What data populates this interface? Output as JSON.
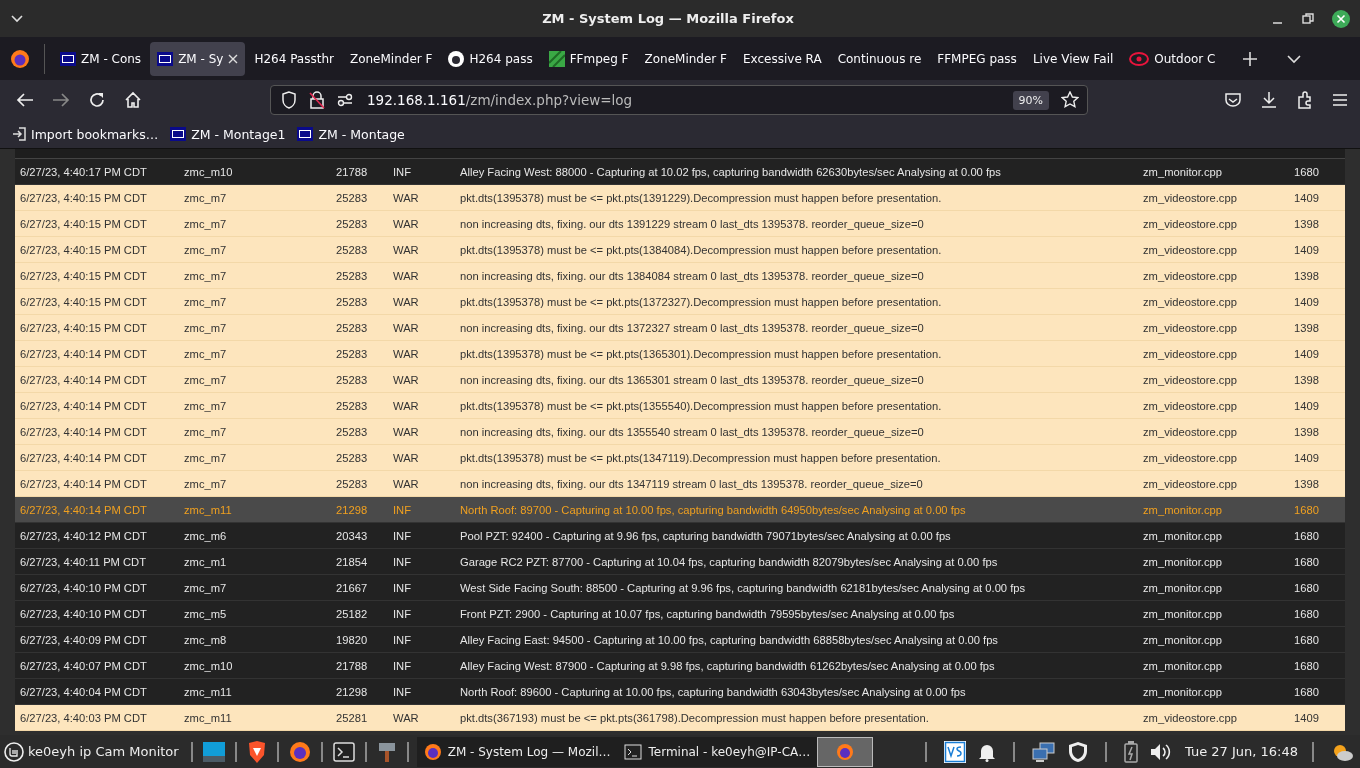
{
  "window": {
    "title": "ZM - System Log — Mozilla Firefox"
  },
  "tabs": [
    {
      "label": "ZM - Cons",
      "kind": "zm",
      "selected": false
    },
    {
      "label": "ZM - Sy",
      "kind": "zm",
      "selected": true
    },
    {
      "label": "H264 Passthr",
      "kind": "plain",
      "selected": false
    },
    {
      "label": "ZoneMinder F",
      "kind": "plain",
      "selected": false
    },
    {
      "label": "H264 pass",
      "kind": "github",
      "selected": false
    },
    {
      "label": "FFmpeg F",
      "kind": "ffmpeg",
      "selected": false
    },
    {
      "label": "ZoneMinder F",
      "kind": "plain",
      "selected": false
    },
    {
      "label": "Excessive RA",
      "kind": "plain",
      "selected": false
    },
    {
      "label": "Continuous re",
      "kind": "plain",
      "selected": false
    },
    {
      "label": "FFMPEG pass",
      "kind": "plain",
      "selected": false
    },
    {
      "label": "Live View Fail",
      "kind": "plain",
      "selected": false
    },
    {
      "label": "Outdoor C",
      "kind": "eye",
      "selected": false
    }
  ],
  "address": {
    "host": "192.168.1.161",
    "path": "/zm/index.php?view=log",
    "zoom": "90%"
  },
  "bookmarks": [
    {
      "label": "Import bookmarks…",
      "kind": "import"
    },
    {
      "label": "ZM - Montage1",
      "kind": "zm"
    },
    {
      "label": "ZM - Montage",
      "kind": "zm"
    }
  ],
  "log": {
    "rows": [
      {
        "time": "6/27/23, 4:40:17 PM CDT",
        "component": "zmc_m10",
        "pid": "21788",
        "level": "INF",
        "message": "Alley Facing West: 88000 - Capturing at 10.02 fps, capturing bandwidth 62630bytes/sec Analysing at 0.00 fps",
        "file": "zm_monitor.cpp",
        "line": "1680",
        "selected": false
      },
      {
        "time": "6/27/23, 4:40:15 PM CDT",
        "component": "zmc_m7",
        "pid": "25283",
        "level": "WAR",
        "message": "pkt.dts(1395378) must be <= pkt.pts(1391229).Decompression must happen before presentation.",
        "file": "zm_videostore.cpp",
        "line": "1409",
        "selected": false
      },
      {
        "time": "6/27/23, 4:40:15 PM CDT",
        "component": "zmc_m7",
        "pid": "25283",
        "level": "WAR",
        "message": "non increasing dts, fixing. our dts 1391229 stream 0 last_dts 1395378. reorder_queue_size=0",
        "file": "zm_videostore.cpp",
        "line": "1398",
        "selected": false
      },
      {
        "time": "6/27/23, 4:40:15 PM CDT",
        "component": "zmc_m7",
        "pid": "25283",
        "level": "WAR",
        "message": "pkt.dts(1395378) must be <= pkt.pts(1384084).Decompression must happen before presentation.",
        "file": "zm_videostore.cpp",
        "line": "1409",
        "selected": false
      },
      {
        "time": "6/27/23, 4:40:15 PM CDT",
        "component": "zmc_m7",
        "pid": "25283",
        "level": "WAR",
        "message": "non increasing dts, fixing. our dts 1384084 stream 0 last_dts 1395378. reorder_queue_size=0",
        "file": "zm_videostore.cpp",
        "line": "1398",
        "selected": false
      },
      {
        "time": "6/27/23, 4:40:15 PM CDT",
        "component": "zmc_m7",
        "pid": "25283",
        "level": "WAR",
        "message": "pkt.dts(1395378) must be <= pkt.pts(1372327).Decompression must happen before presentation.",
        "file": "zm_videostore.cpp",
        "line": "1409",
        "selected": false
      },
      {
        "time": "6/27/23, 4:40:15 PM CDT",
        "component": "zmc_m7",
        "pid": "25283",
        "level": "WAR",
        "message": "non increasing dts, fixing. our dts 1372327 stream 0 last_dts 1395378. reorder_queue_size=0",
        "file": "zm_videostore.cpp",
        "line": "1398",
        "selected": false
      },
      {
        "time": "6/27/23, 4:40:14 PM CDT",
        "component": "zmc_m7",
        "pid": "25283",
        "level": "WAR",
        "message": "pkt.dts(1395378) must be <= pkt.pts(1365301).Decompression must happen before presentation.",
        "file": "zm_videostore.cpp",
        "line": "1409",
        "selected": false
      },
      {
        "time": "6/27/23, 4:40:14 PM CDT",
        "component": "zmc_m7",
        "pid": "25283",
        "level": "WAR",
        "message": "non increasing dts, fixing. our dts 1365301 stream 0 last_dts 1395378. reorder_queue_size=0",
        "file": "zm_videostore.cpp",
        "line": "1398",
        "selected": false
      },
      {
        "time": "6/27/23, 4:40:14 PM CDT",
        "component": "zmc_m7",
        "pid": "25283",
        "level": "WAR",
        "message": "pkt.dts(1395378) must be <= pkt.pts(1355540).Decompression must happen before presentation.",
        "file": "zm_videostore.cpp",
        "line": "1409",
        "selected": false
      },
      {
        "time": "6/27/23, 4:40:14 PM CDT",
        "component": "zmc_m7",
        "pid": "25283",
        "level": "WAR",
        "message": "non increasing dts, fixing. our dts 1355540 stream 0 last_dts 1395378. reorder_queue_size=0",
        "file": "zm_videostore.cpp",
        "line": "1398",
        "selected": false
      },
      {
        "time": "6/27/23, 4:40:14 PM CDT",
        "component": "zmc_m7",
        "pid": "25283",
        "level": "WAR",
        "message": "pkt.dts(1395378) must be <= pkt.pts(1347119).Decompression must happen before presentation.",
        "file": "zm_videostore.cpp",
        "line": "1409",
        "selected": false
      },
      {
        "time": "6/27/23, 4:40:14 PM CDT",
        "component": "zmc_m7",
        "pid": "25283",
        "level": "WAR",
        "message": "non increasing dts, fixing. our dts 1347119 stream 0 last_dts 1395378. reorder_queue_size=0",
        "file": "zm_videostore.cpp",
        "line": "1398",
        "selected": false
      },
      {
        "time": "6/27/23, 4:40:14 PM CDT",
        "component": "zmc_m11",
        "pid": "21298",
        "level": "INF",
        "message": "North Roof: 89700 - Capturing at 10.00 fps, capturing bandwidth 64950bytes/sec Analysing at 0.00 fps",
        "file": "zm_monitor.cpp",
        "line": "1680",
        "selected": true
      },
      {
        "time": "6/27/23, 4:40:12 PM CDT",
        "component": "zmc_m6",
        "pid": "20343",
        "level": "INF",
        "message": "Pool PZT: 92400 - Capturing at 9.96 fps, capturing bandwidth 79071bytes/sec Analysing at 0.00 fps",
        "file": "zm_monitor.cpp",
        "line": "1680",
        "selected": false
      },
      {
        "time": "6/27/23, 4:40:11 PM CDT",
        "component": "zmc_m1",
        "pid": "21854",
        "level": "INF",
        "message": "Garage RC2 PZT: 87700 - Capturing at 10.04 fps, capturing bandwidth 82079bytes/sec Analysing at 0.00 fps",
        "file": "zm_monitor.cpp",
        "line": "1680",
        "selected": false
      },
      {
        "time": "6/27/23, 4:40:10 PM CDT",
        "component": "zmc_m7",
        "pid": "21667",
        "level": "INF",
        "message": "West Side Facing South: 88500 - Capturing at 9.96 fps, capturing bandwidth 62181bytes/sec Analysing at 0.00 fps",
        "file": "zm_monitor.cpp",
        "line": "1680",
        "selected": false
      },
      {
        "time": "6/27/23, 4:40:10 PM CDT",
        "component": "zmc_m5",
        "pid": "25182",
        "level": "INF",
        "message": "Front PZT: 2900 - Capturing at 10.07 fps, capturing bandwidth 79595bytes/sec Analysing at 0.00 fps",
        "file": "zm_monitor.cpp",
        "line": "1680",
        "selected": false
      },
      {
        "time": "6/27/23, 4:40:09 PM CDT",
        "component": "zmc_m8",
        "pid": "19820",
        "level": "INF",
        "message": "Alley Facing East: 94500 - Capturing at 10.00 fps, capturing bandwidth 68858bytes/sec Analysing at 0.00 fps",
        "file": "zm_monitor.cpp",
        "line": "1680",
        "selected": false
      },
      {
        "time": "6/27/23, 4:40:07 PM CDT",
        "component": "zmc_m10",
        "pid": "21788",
        "level": "INF",
        "message": "Alley Facing West: 87900 - Capturing at 9.98 fps, capturing bandwidth 61262bytes/sec Analysing at 0.00 fps",
        "file": "zm_monitor.cpp",
        "line": "1680",
        "selected": false
      },
      {
        "time": "6/27/23, 4:40:04 PM CDT",
        "component": "zmc_m11",
        "pid": "21298",
        "level": "INF",
        "message": "North Roof: 89600 - Capturing at 10.00 fps, capturing bandwidth 63043bytes/sec Analysing at 0.00 fps",
        "file": "zm_monitor.cpp",
        "line": "1680",
        "selected": false
      },
      {
        "time": "6/27/23, 4:40:03 PM CDT",
        "component": "zmc_m11",
        "pid": "25281",
        "level": "WAR",
        "message": "pkt.dts(367193) must be <= pkt.pts(361798).Decompression must happen before presentation.",
        "file": "zm_videostore.cpp",
        "line": "1409",
        "selected": false
      }
    ]
  },
  "taskbar": {
    "menu_label": "ke0eyh ip Cam Monitor",
    "windows": [
      {
        "label": "ZM - System Log — Mozil…",
        "kind": "firefox",
        "selected": false
      },
      {
        "label": "Terminal - ke0eyh@IP-CA…",
        "kind": "terminal",
        "selected": false
      },
      {
        "kind": "firefox",
        "selected": true
      }
    ],
    "clock": "Tue 27 Jun, 16:48"
  }
}
